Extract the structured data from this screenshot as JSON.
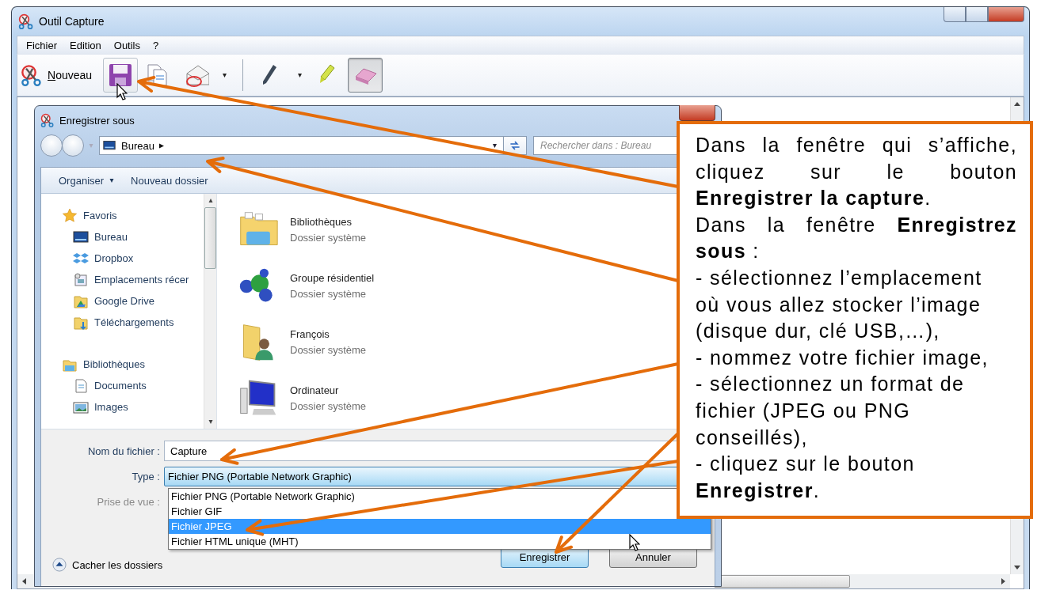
{
  "window": {
    "title": "Outil Capture"
  },
  "menu": [
    "Fichier",
    "Edition",
    "Outils",
    "?"
  ],
  "toolbar": {
    "new_button": {
      "label": "Nouveau"
    },
    "tools": [
      {
        "kind": "save",
        "hovered": true
      },
      {
        "kind": "copy"
      },
      {
        "kind": "send"
      },
      {
        "kind": "dropdown"
      },
      {
        "kind": "separator"
      },
      {
        "kind": "pen",
        "selected": false
      },
      {
        "kind": "dropdown"
      },
      {
        "kind": "highlighter",
        "selected": false
      },
      {
        "kind": "eraser",
        "selected": true
      }
    ]
  },
  "dialog": {
    "title": "Enregistrer sous",
    "address": "Bureau",
    "search": {
      "placeholder": "Rechercher dans : Bureau"
    },
    "commands": [
      {
        "label": "Organiser",
        "has_menu": true
      },
      {
        "label": "Nouveau dossier",
        "has_menu": false
      }
    ],
    "nav": [
      {
        "label": "Favoris",
        "kind": "star",
        "children": [
          {
            "label": "Bureau",
            "kind": "desktop"
          },
          {
            "label": "Dropbox",
            "kind": "dropbox"
          },
          {
            "label": "Emplacements récer",
            "kind": "recent"
          },
          {
            "label": "Google Drive",
            "kind": "gdrive"
          },
          {
            "label": "Téléchargements",
            "kind": "download"
          }
        ]
      },
      {
        "label": "Bibliothèques",
        "kind": "library",
        "children": [
          {
            "label": "Documents",
            "kind": "document"
          },
          {
            "label": "Images",
            "kind": "image"
          }
        ]
      }
    ],
    "items": [
      {
        "name": "Bibliothèques",
        "type": "Dossier système",
        "kind": "library"
      },
      {
        "name": "Groupe résidentiel",
        "type": "Dossier système",
        "kind": "homegroup"
      },
      {
        "name": "François",
        "type": "Dossier système",
        "kind": "user"
      },
      {
        "name": "Ordinateur",
        "type": "Dossier système",
        "kind": "computer"
      }
    ],
    "filename": {
      "label": "Nom du fichier :",
      "value": "Capture"
    },
    "type": {
      "label": "Type :",
      "value": "Fichier PNG (Portable Network Graphic)",
      "options": [
        {
          "label": "Fichier PNG (Portable Network Graphic)",
          "highlighted": false
        },
        {
          "label": "Fichier GIF",
          "highlighted": false
        },
        {
          "label": "Fichier JPEG",
          "highlighted": true
        },
        {
          "label": "Fichier HTML unique (MHT)",
          "highlighted": false
        }
      ]
    },
    "shot": {
      "label": "Prise de vue :",
      "disabled": true
    },
    "hide_folders": "Cacher les dossiers",
    "buttons": [
      {
        "label": "Enregistrer",
        "kind": "default"
      },
      {
        "label": "Annuler",
        "kind": "normal"
      }
    ]
  },
  "callout": {
    "paragraphs": [
      {
        "text": "Dans la fenêtre qui s’affiche, cliquez sur le bouton **Enregistrer la capture**.",
        "justify": true
      },
      {
        "text": "Dans la fenêtre **Enregistrez sous** :",
        "justify": true
      },
      {
        "text": "- sélectionnez l’emplacement\noù vous allez stocker l’image\n(disque dur, clé USB,…),"
      },
      {
        "text": "- nommez votre fichier image,"
      },
      {
        "text": "- sélectionnez un format de\nfichier (JPEG ou PNG\nconseillés),"
      },
      {
        "text": "- cliquez sur le bouton\n**Enregistrer**."
      }
    ]
  }
}
